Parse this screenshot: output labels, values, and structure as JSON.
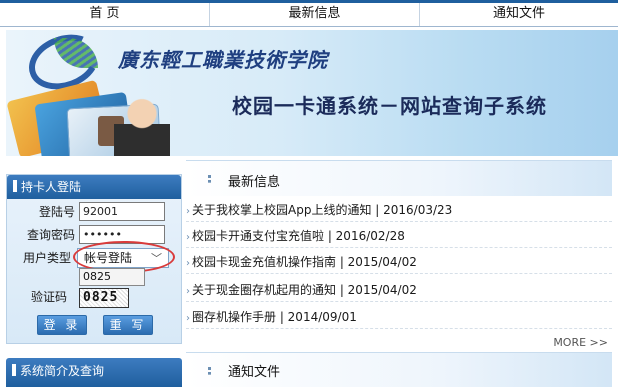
{
  "nav": {
    "home": "首 页",
    "news": "最新信息",
    "notice": "通知文件"
  },
  "banner": {
    "school_name": "廣东輕工職業技術学院",
    "system_title": "校园一卡通系统－网站查询子系统"
  },
  "login": {
    "panel_title": "持卡人登陆",
    "fields": {
      "account_label": "登陆号",
      "account_value": "92001",
      "password_label": "查询密码",
      "password_value": "••••••",
      "user_type_label": "用户类型",
      "user_type_value": "帐号登陆",
      "captcha_label": "验证码",
      "captcha_value": "0825",
      "captcha_image_text": "0825"
    },
    "buttons": {
      "login": "登 录",
      "reset": "重 写"
    }
  },
  "intro_panel_title": "系统简介及查询",
  "news": {
    "title": "最新信息",
    "items": [
      {
        "text": "关于我校掌上校园App上线的通知 | 2016/03/23"
      },
      {
        "text": "校园卡开通支付宝充值啦 | 2016/02/28"
      },
      {
        "text": "校园卡现金充值机操作指南 | 2015/04/02"
      },
      {
        "text": "关于现金圈存机起用的通知 | 2015/04/02"
      },
      {
        "text": "圈存机操作手册 | 2014/09/01"
      }
    ],
    "more_label": "MORE >>"
  },
  "notice": {
    "title": "通知文件"
  },
  "colors": {
    "brand_blue": "#1f5f9e",
    "highlight_red": "#d93b3b"
  }
}
